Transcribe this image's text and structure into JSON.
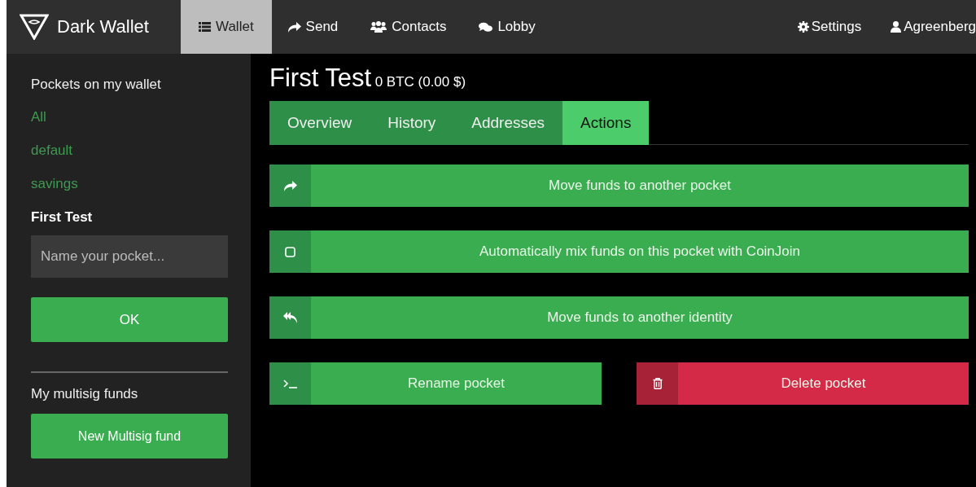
{
  "navbar": {
    "brand": "Dark Wallet",
    "items": [
      {
        "label": "Wallet",
        "kind": "list",
        "selected": true
      },
      {
        "label": "Send",
        "kind": "send",
        "selected": false
      },
      {
        "label": "Contacts",
        "kind": "contacts",
        "selected": false
      },
      {
        "label": "Lobby",
        "kind": "chat",
        "selected": false
      }
    ],
    "right_items": [
      {
        "label": "Settings",
        "kind": "settings"
      },
      {
        "label": "Agreenberg",
        "kind": "user"
      }
    ]
  },
  "sidebar": {
    "heading": "Pockets on my wallet",
    "pockets": [
      {
        "label": "All",
        "selected": false
      },
      {
        "label": "default",
        "selected": false
      },
      {
        "label": "savings",
        "selected": false
      },
      {
        "label": "First Test",
        "selected": true
      }
    ],
    "name_field": {
      "placeholder": "Name your pocket..."
    },
    "ok_button": "OK",
    "multisig_heading": "My multisig funds",
    "multisig_button": "New Multisig fund"
  },
  "main": {
    "title": "First Test",
    "balance": "0 BTC (0.00 $)",
    "tabs": [
      {
        "label": "Overview",
        "selected": false
      },
      {
        "label": "History",
        "selected": false
      },
      {
        "label": "Addresses",
        "selected": false
      },
      {
        "label": "Actions",
        "selected": true
      }
    ],
    "actions": [
      {
        "label": "Move funds to another pocket",
        "kind": "forward"
      },
      {
        "label": "Automatically mix funds on this pocket with CoinJoin",
        "kind": "toggle",
        "checked": false
      },
      {
        "label": "Move funds to another identity",
        "kind": "reply"
      },
      {
        "label": "Rename pocket",
        "kind": "rename"
      },
      {
        "label": "Delete pocket",
        "kind": "delete"
      }
    ]
  }
}
